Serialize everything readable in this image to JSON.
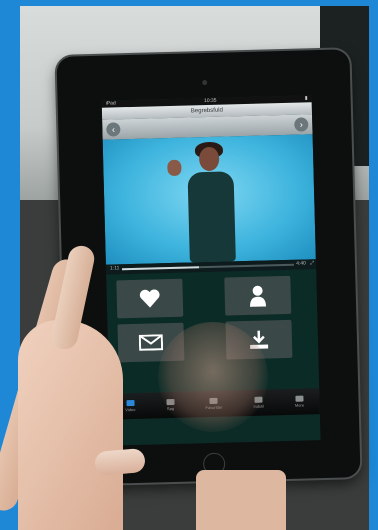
{
  "app": {
    "title": "Begrebsfuld",
    "status_time": "10:35",
    "status_carrier": "iPad"
  },
  "player": {
    "elapsed": "1:11",
    "duration": "4:40",
    "progress": 0.45
  },
  "tiles": [
    {
      "icon": "heart-icon"
    },
    {
      "icon": "person-icon"
    },
    {
      "icon": "envelope-icon"
    },
    {
      "icon": "download-icon"
    }
  ],
  "tabbar": {
    "items": [
      {
        "label": "Video",
        "icon": "video-icon",
        "active": true
      },
      {
        "label": "Søg",
        "icon": "search-icon",
        "active": false
      },
      {
        "label": "Favoritter",
        "icon": "folder-icon",
        "active": false
      },
      {
        "label": "Indstil",
        "icon": "upload-icon",
        "active": false
      },
      {
        "label": "Mere",
        "icon": "more-icon",
        "active": false
      }
    ]
  },
  "colors": {
    "frame": "#1e88d6",
    "video_bg": "#3cb3dd",
    "active_tab": "#2b86d8"
  }
}
